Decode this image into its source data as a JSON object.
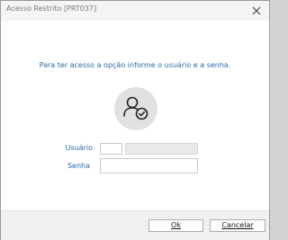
{
  "window": {
    "title": "Acesso Restrito [PRT037]"
  },
  "dialog": {
    "message": "Para ter acesso a opção informe o usuário e a senha."
  },
  "form": {
    "user_label": "Usuário",
    "user_code_value": "",
    "user_name_value": "",
    "password_label": "Senha",
    "password_value": ""
  },
  "buttons": {
    "ok_label": "Ok",
    "cancel_label": "Cancelar"
  },
  "icons": {
    "close": "close-icon",
    "avatar": "user-check-icon"
  },
  "colors": {
    "label_blue": "#2a6aa8",
    "avatar_bg": "#e1e1e1"
  }
}
